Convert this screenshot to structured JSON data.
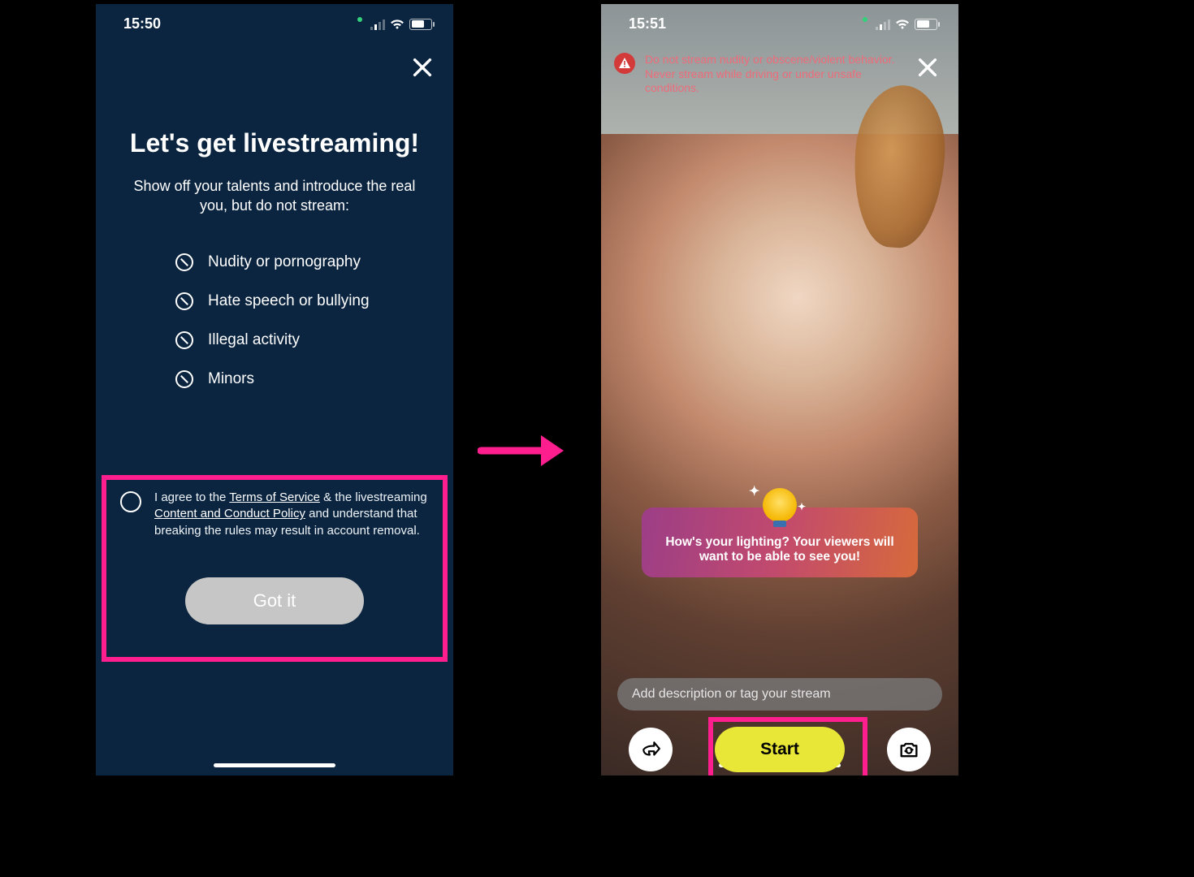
{
  "left": {
    "time": "15:50",
    "title": "Let's get livestreaming!",
    "subtitle": "Show off your talents and introduce the real you, but do not stream:",
    "rules": [
      "Nudity or pornography",
      "Hate speech or bullying",
      "Illegal activity",
      "Minors"
    ],
    "agree_prefix": "I agree to the ",
    "tos_link": "Terms of Service",
    "agree_mid": " & the livestreaming ",
    "policy_link": "Content and Conduct Policy",
    "agree_suffix": " and understand that breaking the rules may result in account removal.",
    "gotit_label": "Got it"
  },
  "right": {
    "time": "15:51",
    "warning": "Do not stream nudity or obscene/violent behavior. Never stream while driving or under unsafe conditions.",
    "tip": "How's your lighting? Your viewers will want to be able to see you!",
    "desc_placeholder": "Add description or tag your stream",
    "start_label": "Start"
  }
}
